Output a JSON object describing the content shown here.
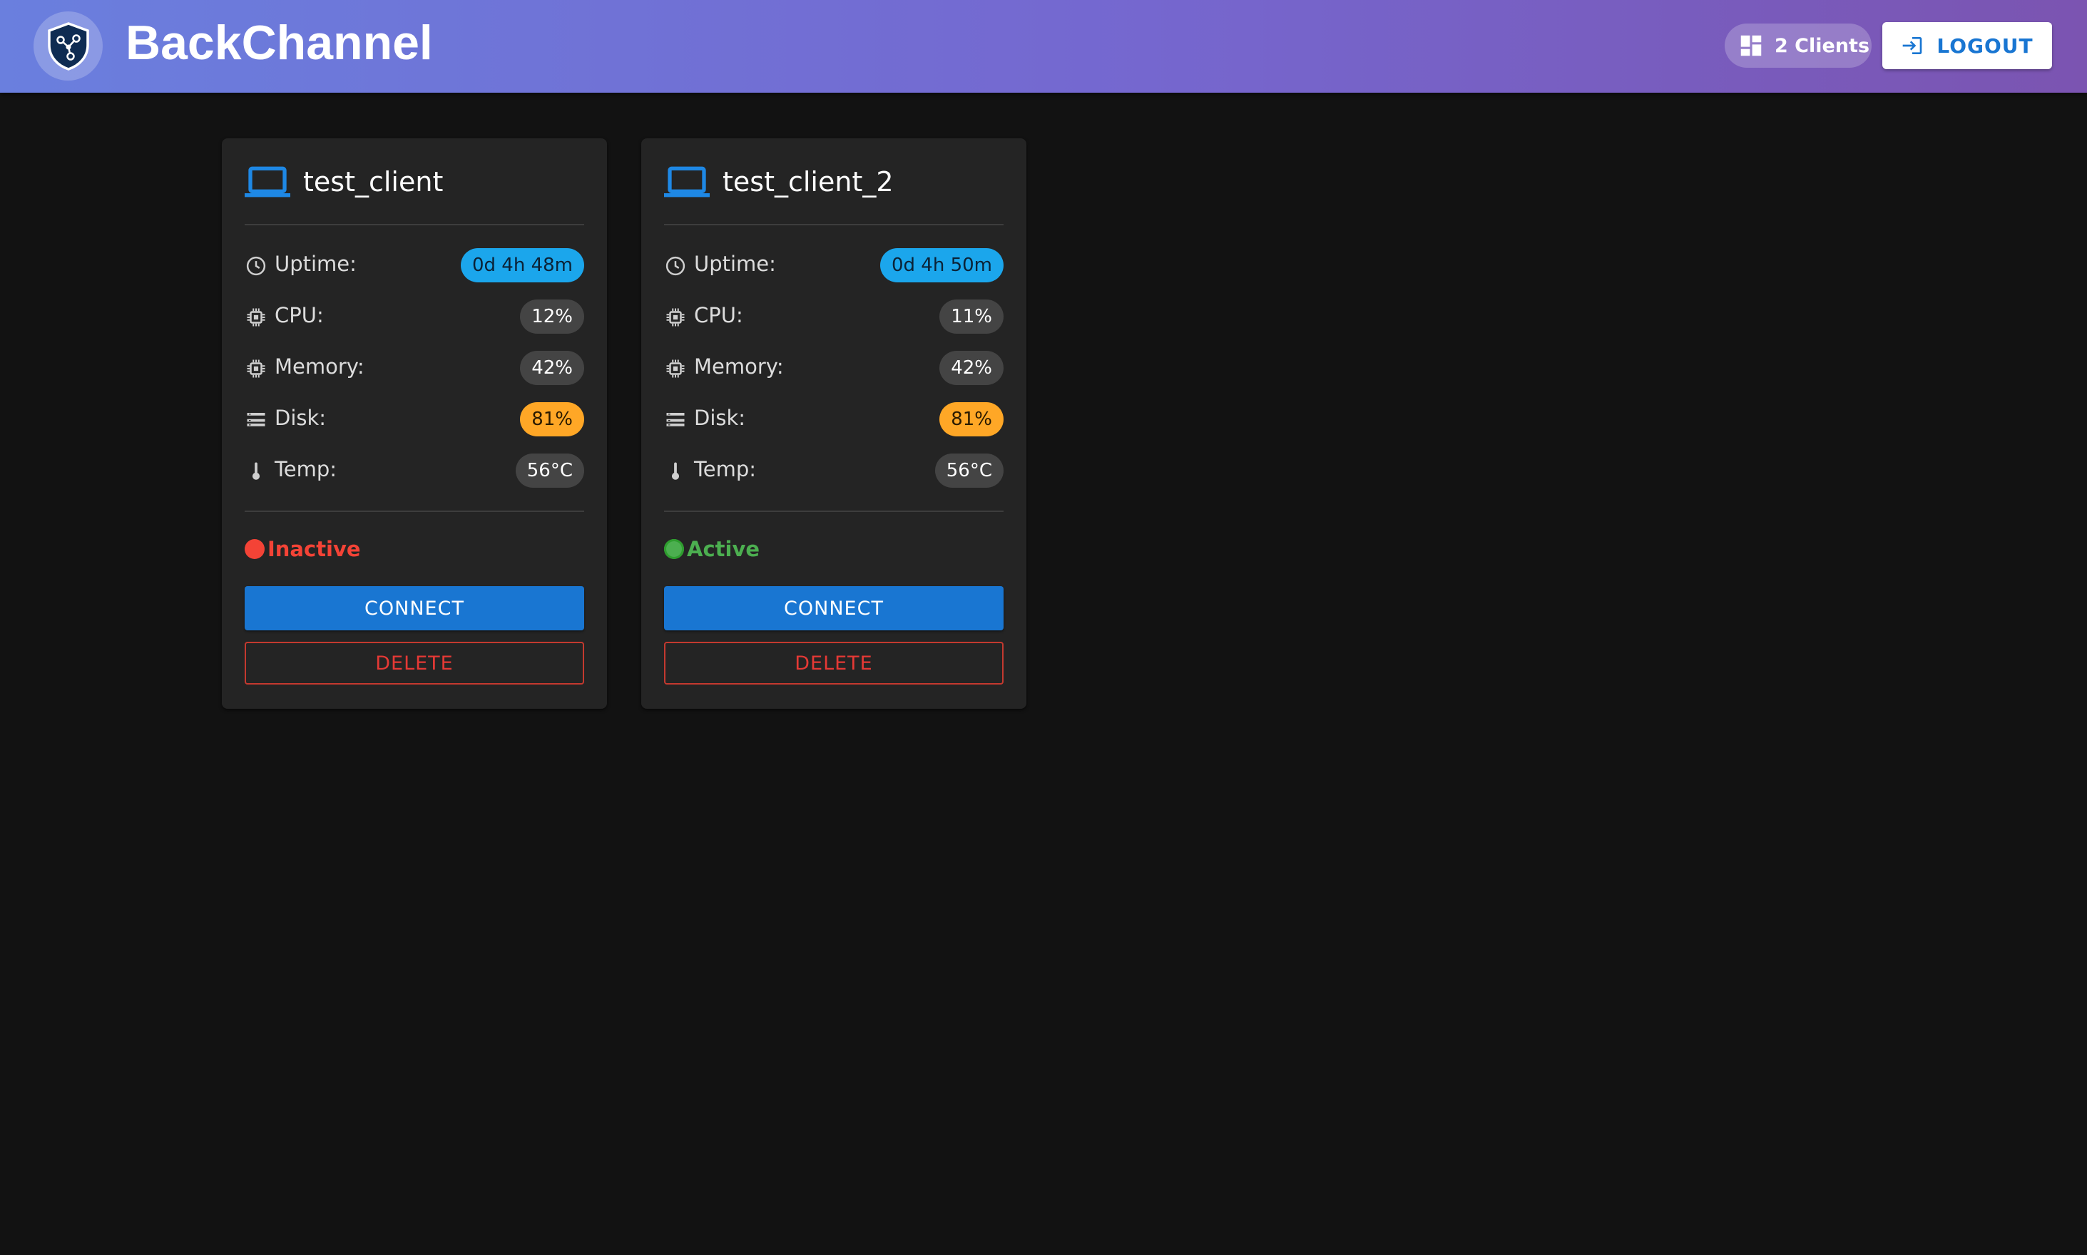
{
  "header": {
    "brand": "BackChannel",
    "clients_count": "2 Clients",
    "logout_label": "LOGOUT",
    "icons": {
      "logo": "shield-network-icon",
      "clients": "dashboard-icon",
      "logout": "login-arrow-icon"
    }
  },
  "colors": {
    "accent": "#1976d2",
    "info": "#1ba6ec",
    "warning": "#ffa726",
    "inactive": "#f44336",
    "active": "#4caf50",
    "delete": "#e53935"
  },
  "clients": [
    {
      "name": "test_client",
      "stats": [
        {
          "label": "Uptime:",
          "value": "0d 4h 48m",
          "icon": "clock-icon"
        },
        {
          "label": "CPU:",
          "value": "12%",
          "icon": "chip-icon"
        },
        {
          "label": "Memory:",
          "value": "42%",
          "icon": "chip-icon"
        },
        {
          "label": "Disk:",
          "value": "81%",
          "icon": "storage-icon"
        },
        {
          "label": "Temp:",
          "value": "56°C",
          "icon": "thermometer-icon"
        }
      ],
      "status": "Inactive",
      "connect_label": "CONNECT",
      "delete_label": "DELETE"
    },
    {
      "name": "test_client_2",
      "stats": [
        {
          "label": "Uptime:",
          "value": "0d 4h 50m",
          "icon": "clock-icon"
        },
        {
          "label": "CPU:",
          "value": "11%",
          "icon": "chip-icon"
        },
        {
          "label": "Memory:",
          "value": "42%",
          "icon": "chip-icon"
        },
        {
          "label": "Disk:",
          "value": "81%",
          "icon": "storage-icon"
        },
        {
          "label": "Temp:",
          "value": "56°C",
          "icon": "thermometer-icon"
        }
      ],
      "status": "Active",
      "connect_label": "CONNECT",
      "delete_label": "DELETE"
    }
  ]
}
